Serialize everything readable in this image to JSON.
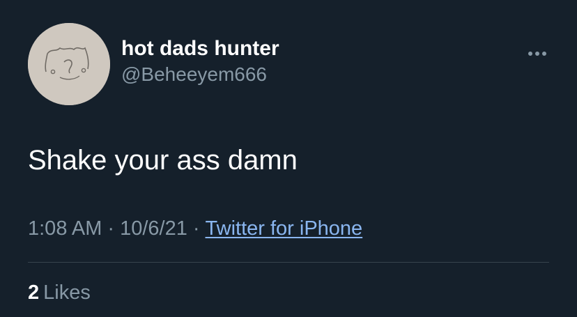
{
  "user": {
    "display_name": "hot dads hunter",
    "handle": "@Beheeyem666",
    "avatar_icon": "doodle-face-avatar"
  },
  "header": {
    "more_icon": "more-horizontal-icon"
  },
  "tweet": {
    "text": "Shake your ass damn",
    "time": "1:08 AM",
    "date": "10/6/21",
    "separator": "·",
    "source": "Twitter for iPhone"
  },
  "stats": {
    "likes_count": "2",
    "likes_label": "Likes"
  },
  "colors": {
    "background": "#15202b",
    "primary_text": "#ffffff",
    "secondary_text": "#8899a6",
    "link": "#8ab6f0",
    "divider": "#38444d"
  }
}
